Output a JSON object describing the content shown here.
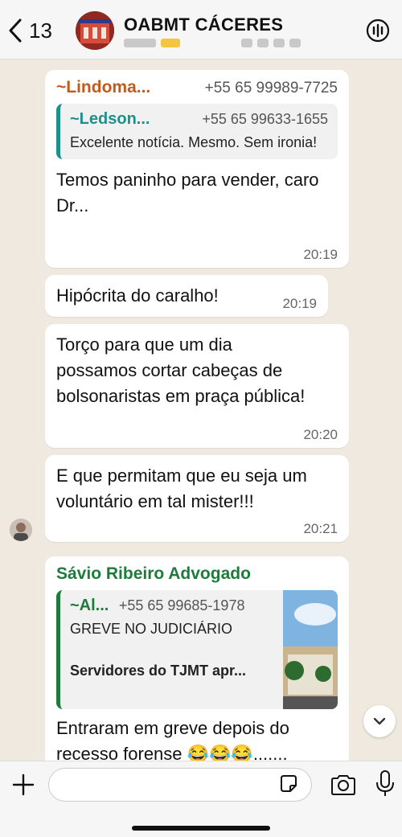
{
  "header": {
    "back_count": "13",
    "group_name": "OABMT CÁCERES"
  },
  "messages": [
    {
      "sender": "~Lindoma...",
      "phone": "+55 65 99989-7725",
      "quote": {
        "sender": "~Ledson...",
        "phone": "+55 65 99633-1655",
        "text": "Excelente notícia. Mesmo. Sem ironia!"
      },
      "text": "Temos paninho para vender, caro Dr...",
      "time": "20:19"
    },
    {
      "text": "Hipócrita do caralho!",
      "time": "20:19"
    },
    {
      "text": "Torço para que um dia possamos cortar cabeças de bolsonaristas em praça pública!",
      "time": "20:20"
    },
    {
      "text": "E que permitam que eu seja um voluntário em tal mister!!!",
      "time": "20:21"
    },
    {
      "sender": "Sávio Ribeiro Advogado",
      "quote": {
        "sender": "~Al...",
        "phone": "+55 65 99685-1978",
        "title": "GREVE NO JUDICIÁRIO",
        "text": "Servidores do TJMT apr..."
      },
      "text": "Entraram em greve depois do recesso forense 😂😂😂......."
    }
  ],
  "composer": {
    "placeholder": ""
  },
  "colors": {
    "chat_background": "#efe9df",
    "sender_orange": "#c25a1c",
    "sender_green": "#1f7a3b",
    "quote_bar": "#1f8f8a"
  },
  "icons": [
    "chevron-left-icon",
    "voice-chat-icon",
    "plus-icon",
    "sticker-icon",
    "camera-icon",
    "microphone-icon",
    "chevron-down-icon"
  ]
}
